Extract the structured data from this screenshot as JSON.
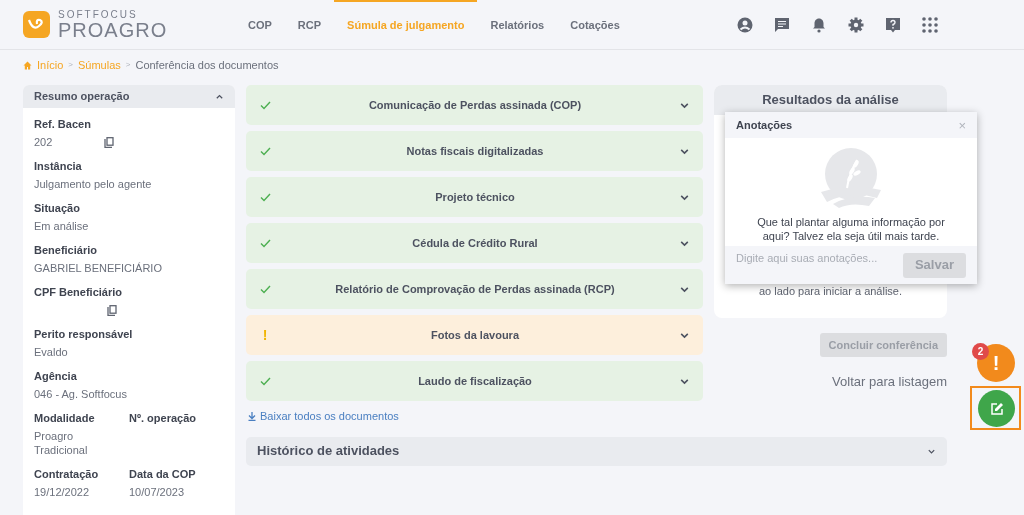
{
  "brand": {
    "top": "SOFTFOCUS",
    "name": "PROAGRO"
  },
  "nav": [
    {
      "label": "COP",
      "selected": false
    },
    {
      "label": "RCP",
      "selected": false
    },
    {
      "label": "Súmula de julgamento",
      "selected": true
    },
    {
      "label": "Relatórios",
      "selected": false
    },
    {
      "label": "Cotações",
      "selected": false
    }
  ],
  "breadcrumb_separator": ">",
  "breadcrumb": [
    {
      "label": "Início",
      "link": true
    },
    {
      "label": "Súmulas",
      "link": true
    },
    {
      "label": "Conferência dos documentos",
      "link": false
    }
  ],
  "summary": {
    "title": "Resumo operação",
    "expanded": true,
    "fields": [
      {
        "label": "Ref. Bacen",
        "value": "202",
        "copy": true
      },
      {
        "label": "Instância",
        "value": "Julgamento pelo agente"
      },
      {
        "label": "Situação",
        "value": "Em análise"
      },
      {
        "label": "Beneficiário",
        "value": "GABRIEL BENEFICIÁRIO"
      },
      {
        "label": "CPF Beneficiário",
        "copy": true
      },
      {
        "label": "Perito responsável",
        "value": "Evaldo"
      },
      {
        "label": "Agência",
        "value": "046 - Ag. Softfocus"
      }
    ],
    "pairs": [
      [
        {
          "label": "Modalidade",
          "value": "Proagro Tradicional"
        },
        {
          "label": "Nº. operação"
        }
      ],
      [
        {
          "label": "Contratação",
          "value": "19/12/2022"
        },
        {
          "label": "Data da COP",
          "value": "10/07/2023"
        }
      ]
    ]
  },
  "documents": [
    {
      "title": "Comunicação de Perdas assinada (COP)",
      "kind": "done"
    },
    {
      "title": "Notas fiscais digitalizadas",
      "kind": "done"
    },
    {
      "title": "Projeto técnico",
      "kind": "done"
    },
    {
      "title": "Cédula de Crédito Rural",
      "kind": "done"
    },
    {
      "title": "Relatório de Comprovação de Perdas assinada (RCP)",
      "kind": "done"
    },
    {
      "title": "Fotos da lavoura",
      "kind": "warning",
      "icon": "!"
    },
    {
      "title": "Laudo de fiscalização",
      "kind": "done"
    }
  ],
  "download_link": "Baixar todos os documentos",
  "history": {
    "title": "Histórico de atividades",
    "expanded": false
  },
  "results": {
    "title": "Resultados da análise",
    "text": "ao lado para iniciar a análise."
  },
  "conclude_button": {
    "label": "Concluir conferência",
    "disabled": true
  },
  "back_link": "Voltar para listagem",
  "notes": {
    "title": "Anotações",
    "close": "×",
    "empty_text": "Que tal plantar alguma informação por aqui? Talvez ela seja útil mais tarde.",
    "placeholder": "Digite aqui suas anotações...",
    "save": "Salvar",
    "save_disabled": true
  },
  "alert_fab": {
    "icon": "!",
    "badge": "2"
  }
}
